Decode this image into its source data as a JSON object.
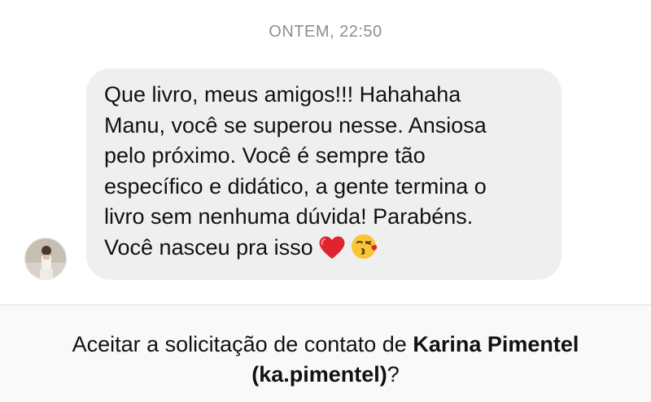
{
  "timestamp": "ONTEM, 22:50",
  "message": {
    "lines": [
      "Que livro, meus amigos!!! Hahahaha",
      "Manu, você se superou nesse. Ansiosa",
      "pelo próximo. Você é sempre tão",
      "específico e didático, a gente termina o",
      "livro sem nenhuma dúvida! Parabéns.",
      "Você nasceu pra isso"
    ],
    "emojis": [
      "red-heart-icon",
      "face-blowing-kiss-icon"
    ]
  },
  "request": {
    "prefix": "Aceitar a solicitação de contato de ",
    "name": "Karina Pimentel",
    "handle": "(ka.pimentel)",
    "suffix": "?"
  },
  "colors": {
    "bubble_bg": "#efefef",
    "timestamp": "#8e8e8e",
    "footer_bg": "#f9f9f9"
  }
}
